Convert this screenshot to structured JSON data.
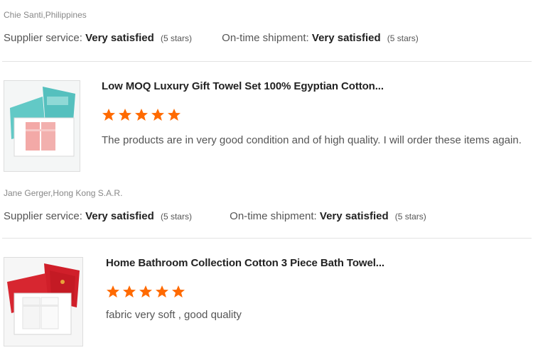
{
  "colors": {
    "star": "#ff6a00",
    "divider": "#e3e3e3"
  },
  "reviews": [
    {
      "reviewer": "Chie Santi,Philippines",
      "supplier_service_label": "Supplier service:",
      "supplier_service_value": "Very satisfied",
      "supplier_service_stars": "(5 stars)",
      "shipment_label": "On-time shipment:",
      "shipment_value": "Very satisfied",
      "shipment_stars": "(5 stars)"
    },
    {
      "product_title": "Low MOQ Luxury Gift Towel Set 100% Egyptian Cotton...",
      "product_image": "teal-gift-box-pink-towels",
      "rating": 5,
      "comment": "The products are in very good condition and of high quality. I will order these items again.",
      "reviewer": "Jane Gerger,Hong Kong S.A.R.",
      "supplier_service_label": "Supplier service:",
      "supplier_service_value": "Very satisfied",
      "supplier_service_stars": "(5 stars)",
      "shipment_label": "On-time shipment:",
      "shipment_value": "Very satisfied",
      "shipment_stars": "(5 stars)"
    },
    {
      "product_title": "Home Bathroom Collection Cotton 3 Piece Bath Towel...",
      "product_image": "red-gift-box-white-towels",
      "rating": 5,
      "comment": "fabric very soft , good quality"
    }
  ]
}
